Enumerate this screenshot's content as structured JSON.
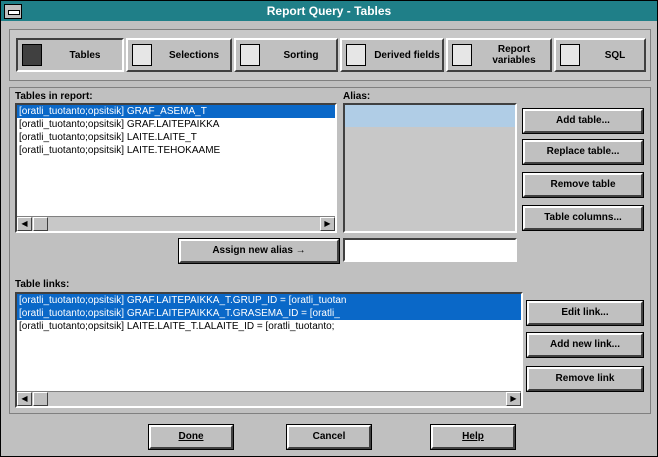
{
  "window": {
    "title": "Report Query - Tables"
  },
  "tabs": [
    {
      "label": "Tables",
      "icon": "table-icon"
    },
    {
      "label": "Selections",
      "icon": "selections-icon"
    },
    {
      "label": "Sorting",
      "icon": "sorting-icon"
    },
    {
      "label": "Derived fields",
      "icon": "derived-fields-icon"
    },
    {
      "label": "Report variables",
      "icon": "report-variables-icon"
    },
    {
      "label": "SQL",
      "icon": "sql-icon"
    }
  ],
  "tables_in_report": {
    "label": "Tables in report:",
    "items": [
      "[oratli_tuotanto;opsitsik] GRAF_ASEMA_T",
      "[oratli_tuotanto;opsitsik] GRAF.LAITEPAIKKA",
      "[oratli_tuotanto;opsitsik] LAITE.LAITE_T",
      "[oratli_tuotanto;opsitsik] LAITE.TEHOKAAME"
    ],
    "selected_index": 0
  },
  "alias": {
    "label": "Alias:",
    "value": ""
  },
  "buttons": {
    "add_table": "Add table...",
    "replace_table": "Replace table...",
    "remove_table": "Remove table",
    "table_columns": "Table columns...",
    "assign_alias": "Assign new alias →",
    "edit_link": "Edit link...",
    "add_new_link": "Add new link...",
    "remove_link": "Remove link",
    "done": "Done",
    "cancel": "Cancel",
    "help": "Help"
  },
  "new_alias_value": "",
  "table_links": {
    "label": "Table links:",
    "items": [
      "[oratli_tuotanto;opsitsik] GRAF.LAITEPAIKKA_T.GRUP_ID = [oratli_tuotan",
      "[oratli_tuotanto;opsitsik] GRAF.LAITEPAIKKA_T.GRASEMA_ID = [oratli_",
      "[oratli_tuotanto;opsitsik] LAITE.LAITE_T.LALAITE_ID = [oratli_tuotanto;"
    ],
    "selected_indices": [
      0,
      1
    ]
  }
}
